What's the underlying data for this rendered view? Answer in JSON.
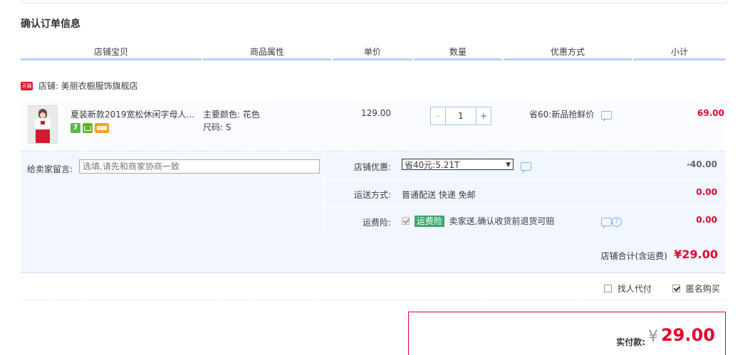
{
  "section_title": "确认订单信息",
  "columns": [
    "店铺宝贝",
    "商品属性",
    "单价",
    "数量",
    "优惠方式",
    "小计"
  ],
  "shop": {
    "badge": "天猫",
    "label": "店铺: 美丽衣橱服饰旗舰店"
  },
  "item": {
    "title": "夏装新款2019宽松休闲字母人物...",
    "attr_color": "主要颜色: 花色",
    "attr_size": "尺码: S",
    "price": "129.00",
    "minus": "-",
    "quantity": "1",
    "plus": "+",
    "promo": "省60:新品抢鲜价",
    "subtotal": "69.00",
    "badge_text": "7"
  },
  "message": {
    "label": "给卖家留言:",
    "placeholder": "选填,请先和商家协商一致"
  },
  "shop_discount": {
    "label": "店铺优惠:",
    "selected": "省40元:5.21T",
    "amount": "-40.00"
  },
  "shipping": {
    "label": "运送方式:",
    "value": "普通配送 快递 免邮",
    "amount": "0.00"
  },
  "insurance": {
    "label": "运费险:",
    "tag": "运费险",
    "desc": "卖家送,确认收货前退货可赔",
    "amount": "0.00",
    "help": "?"
  },
  "shop_total": {
    "label": "店铺合计(含运费)",
    "value": "¥29.00"
  },
  "extras": {
    "proxy_pay": "找人代付",
    "anonymous": "匿名购买"
  },
  "payment": {
    "label": "实付款:",
    "currency": "¥",
    "value": "29.00"
  },
  "colors": {
    "accent_red": "#e4002b",
    "header_line": "#b2d1ff",
    "panel_bg": "#f2f7ff"
  }
}
